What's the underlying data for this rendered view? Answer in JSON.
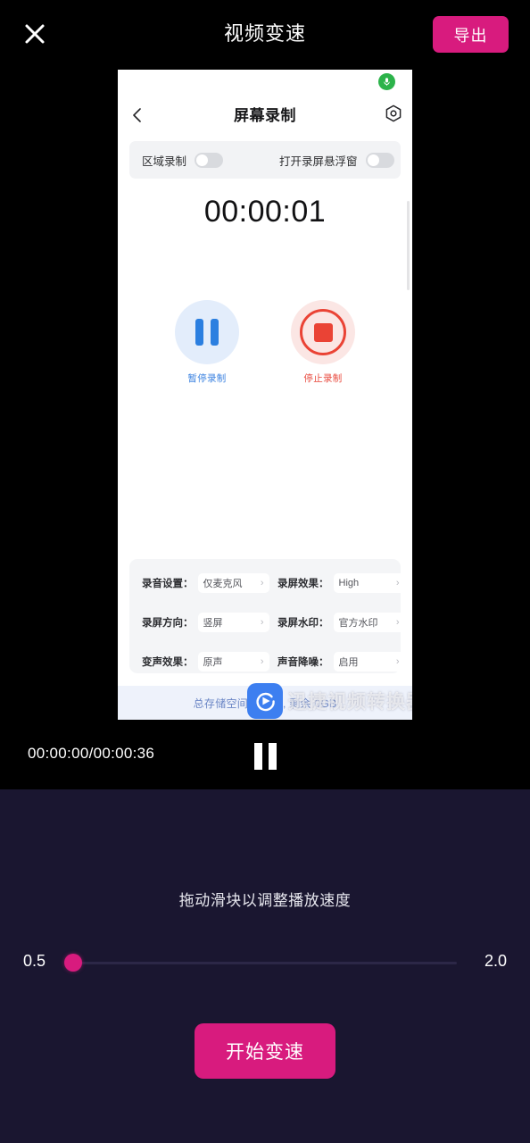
{
  "topbar": {
    "close_icon": "close-icon",
    "title": "视频变速",
    "export_label": "导出"
  },
  "preview": {
    "mic_icon": "microphone-icon",
    "back_icon": "chevron-left-icon",
    "inner_title": "屏幕录制",
    "gear_icon": "gear-icon",
    "toggles": [
      {
        "label": "区域录制",
        "state": "off"
      },
      {
        "label": "打开录屏悬浮窗",
        "state": "off"
      }
    ],
    "timer": "00:00:01",
    "controls": [
      {
        "label": "暂停录制",
        "icon": "pause-icon",
        "color": "#3b82e0"
      },
      {
        "label": "停止录制",
        "icon": "stop-icon",
        "color": "#e8483c"
      }
    ],
    "settings": [
      [
        {
          "key": "录音设置：",
          "value": "仅麦克风",
          "chevron": "›"
        },
        {
          "key": "录屏效果：",
          "value": "High",
          "chevron": "›"
        }
      ],
      [
        {
          "key": "录屏方向：",
          "value": "竖屏",
          "chevron": "›"
        },
        {
          "key": "录屏水印：",
          "value": "官方水印",
          "chevron": "›"
        }
      ],
      [
        {
          "key": "变声效果：",
          "value": "原声",
          "chevron": "›"
        },
        {
          "key": "声音降噪：",
          "value": "启用",
          "chevron": "›"
        }
      ]
    ],
    "storage_text": "总存储空间108GB, 剩余 0GB",
    "watermark": {
      "logo_icon": "play-logo-icon",
      "text": "迅捷视频转换器"
    }
  },
  "playbar": {
    "time": "00:00:00/00:00:36",
    "pause_icon": "pause-icon"
  },
  "speed": {
    "hint": "拖动滑块以调整播放速度",
    "min": "0.5",
    "max": "2.0",
    "start_label": "开始变速"
  },
  "colors": {
    "accent": "#d81b7e",
    "panel_bg": "#1a1630",
    "video_bg": "#000000"
  }
}
